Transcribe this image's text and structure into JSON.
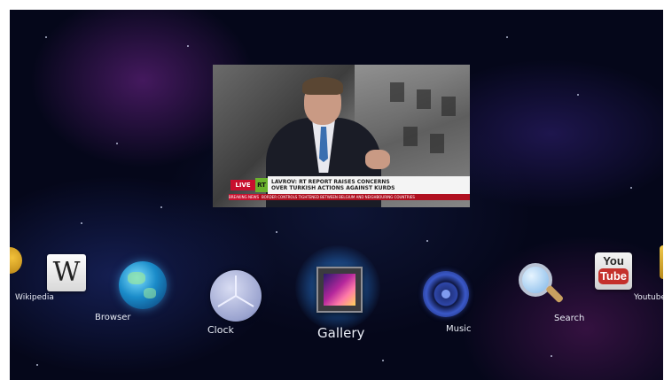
{
  "video": {
    "live_label": "LIVE",
    "channel_logo": "RT",
    "headline_line1": "LAVROV: RT REPORT RAISES CONCERNS",
    "headline_line2": "OVER TURKISH ACTIONS AGAINST KURDS",
    "breaking_label": "BREAKING NEWS",
    "breaking_text": "BORDER CONTROLS TIGHTENED BETWEEN BELGIUM AND NEIGHBOURING COUNTRIES"
  },
  "dock": {
    "items": [
      {
        "label": "Wikipedia",
        "icon": "wikipedia-icon"
      },
      {
        "label": "Browser",
        "icon": "globe-icon"
      },
      {
        "label": "Clock",
        "icon": "clock-icon"
      },
      {
        "label": "Gallery",
        "icon": "gallery-icon",
        "selected": true
      },
      {
        "label": "Music",
        "icon": "speaker-icon"
      },
      {
        "label": "Search",
        "icon": "magnifier-icon"
      },
      {
        "label": "Youtube",
        "icon": "youtube-icon"
      }
    ],
    "partial_left_icon": "partial-app-icon",
    "partial_right_icon": "partial-app-icon"
  },
  "colors": {
    "accent_glow": "#3aa0e8",
    "live_red": "#c8102e",
    "rt_green": "#6bb22e",
    "youtube_red": "#c4302b"
  }
}
